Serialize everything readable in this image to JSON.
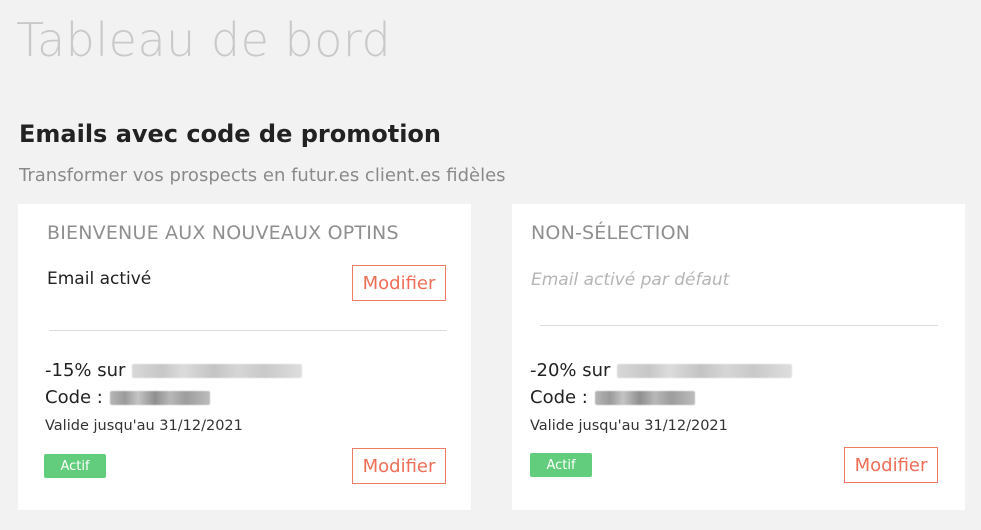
{
  "page_title": "Tableau de bord",
  "section": {
    "title": "Emails avec code de promotion",
    "subtitle": "Transformer vos prospects en futur.es client.es fidèles"
  },
  "cards": [
    {
      "title": "BIENVENUE AUX NOUVEAUX OPTINS",
      "email_status": "Email activé",
      "top_button_label": "Modifier",
      "discount_prefix": "-15% sur",
      "code_prefix": "Code :",
      "validity": "Valide jusqu'au 31/12/2021",
      "status_badge": "Actif",
      "bottom_button_label": "Modifier"
    },
    {
      "title": "NON-SÉLECTION",
      "email_status": "Email activé par défaut",
      "discount_prefix": "-20% sur",
      "code_prefix": "Code :",
      "validity": "Valide jusqu'au 31/12/2021",
      "status_badge": "Actif",
      "bottom_button_label": "Modifier"
    }
  ],
  "colors": {
    "accent_button": "#ee6e57",
    "active_badge": "#62cd7c",
    "background": "#f2f2f2"
  }
}
